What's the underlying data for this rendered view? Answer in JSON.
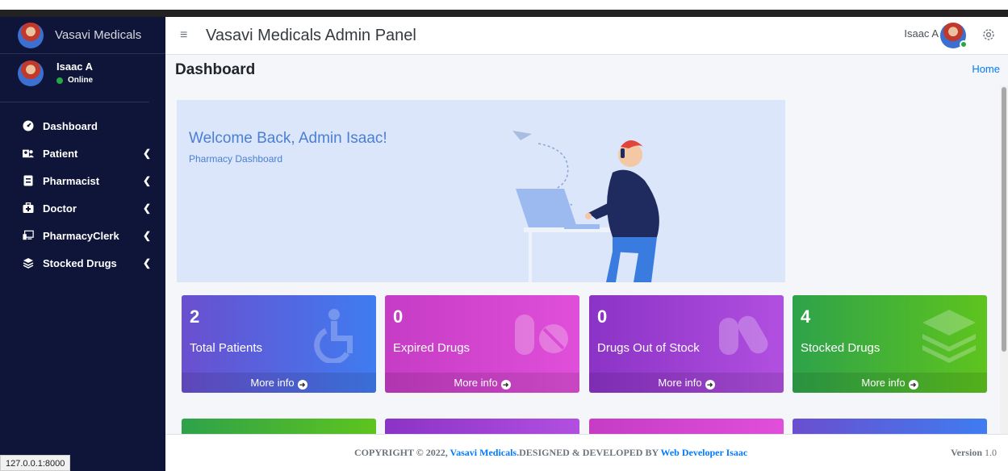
{
  "brand": {
    "name": "Vasavi Medicals"
  },
  "user": {
    "name": "Isaac A",
    "status": "Online"
  },
  "sidebar": {
    "items": [
      {
        "label": "Dashboard",
        "icon": "tachometer-icon",
        "has_submenu": false
      },
      {
        "label": "Patient",
        "icon": "users-icon",
        "has_submenu": true
      },
      {
        "label": "Pharmacist",
        "icon": "id-badge-icon",
        "has_submenu": true
      },
      {
        "label": "Doctor",
        "icon": "briefcase-medical-icon",
        "has_submenu": true
      },
      {
        "label": "PharmacyClerk",
        "icon": "desktop-icon",
        "has_submenu": true
      },
      {
        "label": "Stocked Drugs",
        "icon": "layers-icon",
        "has_submenu": true
      }
    ]
  },
  "header": {
    "title": "Vasavi Medicals Admin Panel",
    "user_label": "Isaac A"
  },
  "content_header": {
    "title": "Dashboard",
    "breadcrumb": "Home"
  },
  "welcome": {
    "title": "Welcome Back, Admin Isaac!",
    "subtitle": "Pharmacy Dashboard"
  },
  "stats": [
    {
      "value": "2",
      "label": "Total Patients",
      "more": "More info",
      "icon": "wheelchair-icon"
    },
    {
      "value": "0",
      "label": "Expired Drugs",
      "more": "More info",
      "icon": "pills-icon"
    },
    {
      "value": "0",
      "label": "Drugs Out of Stock",
      "more": "More info",
      "icon": "capsules-icon"
    },
    {
      "value": "4",
      "label": "Stocked Drugs",
      "more": "More info",
      "icon": "layers-icon"
    }
  ],
  "footer": {
    "copyright_prefix": "COPYRIGHT © 2022, ",
    "company": "Vasavi Medicals",
    "designed_by": ".DESIGNED & DEVELOPED BY ",
    "developer": "Web Developer Isaac",
    "version_label": "Version",
    "version_number": "1.0"
  },
  "status_bar": {
    "url": "127.0.0.1:8000"
  },
  "colors": {
    "sidebar_bg": "#0f1538",
    "accent_link": "#007bff",
    "online": "#28a745"
  }
}
